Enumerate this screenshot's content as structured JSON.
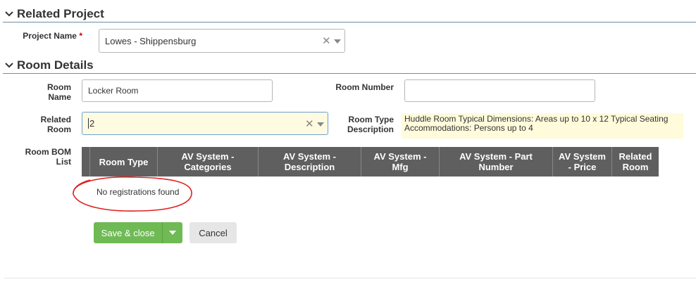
{
  "related_project": {
    "section_title": "Related Project",
    "project_name_label": "Project Name",
    "required_mark": "*",
    "project_name_value": "Lowes - Shippensburg"
  },
  "room_details": {
    "section_title": "Room Details",
    "room_name_label_1": "Room",
    "room_name_label_2": "Name",
    "room_name_value": "Locker Room",
    "room_number_label": "Room Number",
    "room_number_value": "",
    "related_room_label_1": "Related",
    "related_room_label_2": "Room",
    "related_room_value": "2",
    "room_type_desc_label_1": "Room Type",
    "room_type_desc_label_2": "Description",
    "room_type_desc_value_1": "Huddle Room Typical Dimensions:  Areas up to 10 x 12 Typical Seating",
    "room_type_desc_value_2": "Accommodations: Persons up to 4",
    "bom_label_1": "Room BOM",
    "bom_label_2": "List"
  },
  "bom_table": {
    "columns": [
      "Room Type",
      "AV System - Categories",
      "AV System - Description",
      "AV System - Mfg",
      "AV System - Part Number",
      "AV System - Price",
      "Related Room"
    ],
    "empty_text": "No registrations found"
  },
  "actions": {
    "save_label": "Save & close",
    "cancel_label": "Cancel"
  },
  "icons": {
    "clear": "clear-x-icon",
    "dropdown": "chevron-down-icon",
    "collapse": "collapse-chevron-icon"
  },
  "colors": {
    "save_green": "#6fba55",
    "header_gray": "#5f5f5f",
    "annotation_red": "#e02020",
    "highlight_yellow": "#fffbdb"
  }
}
